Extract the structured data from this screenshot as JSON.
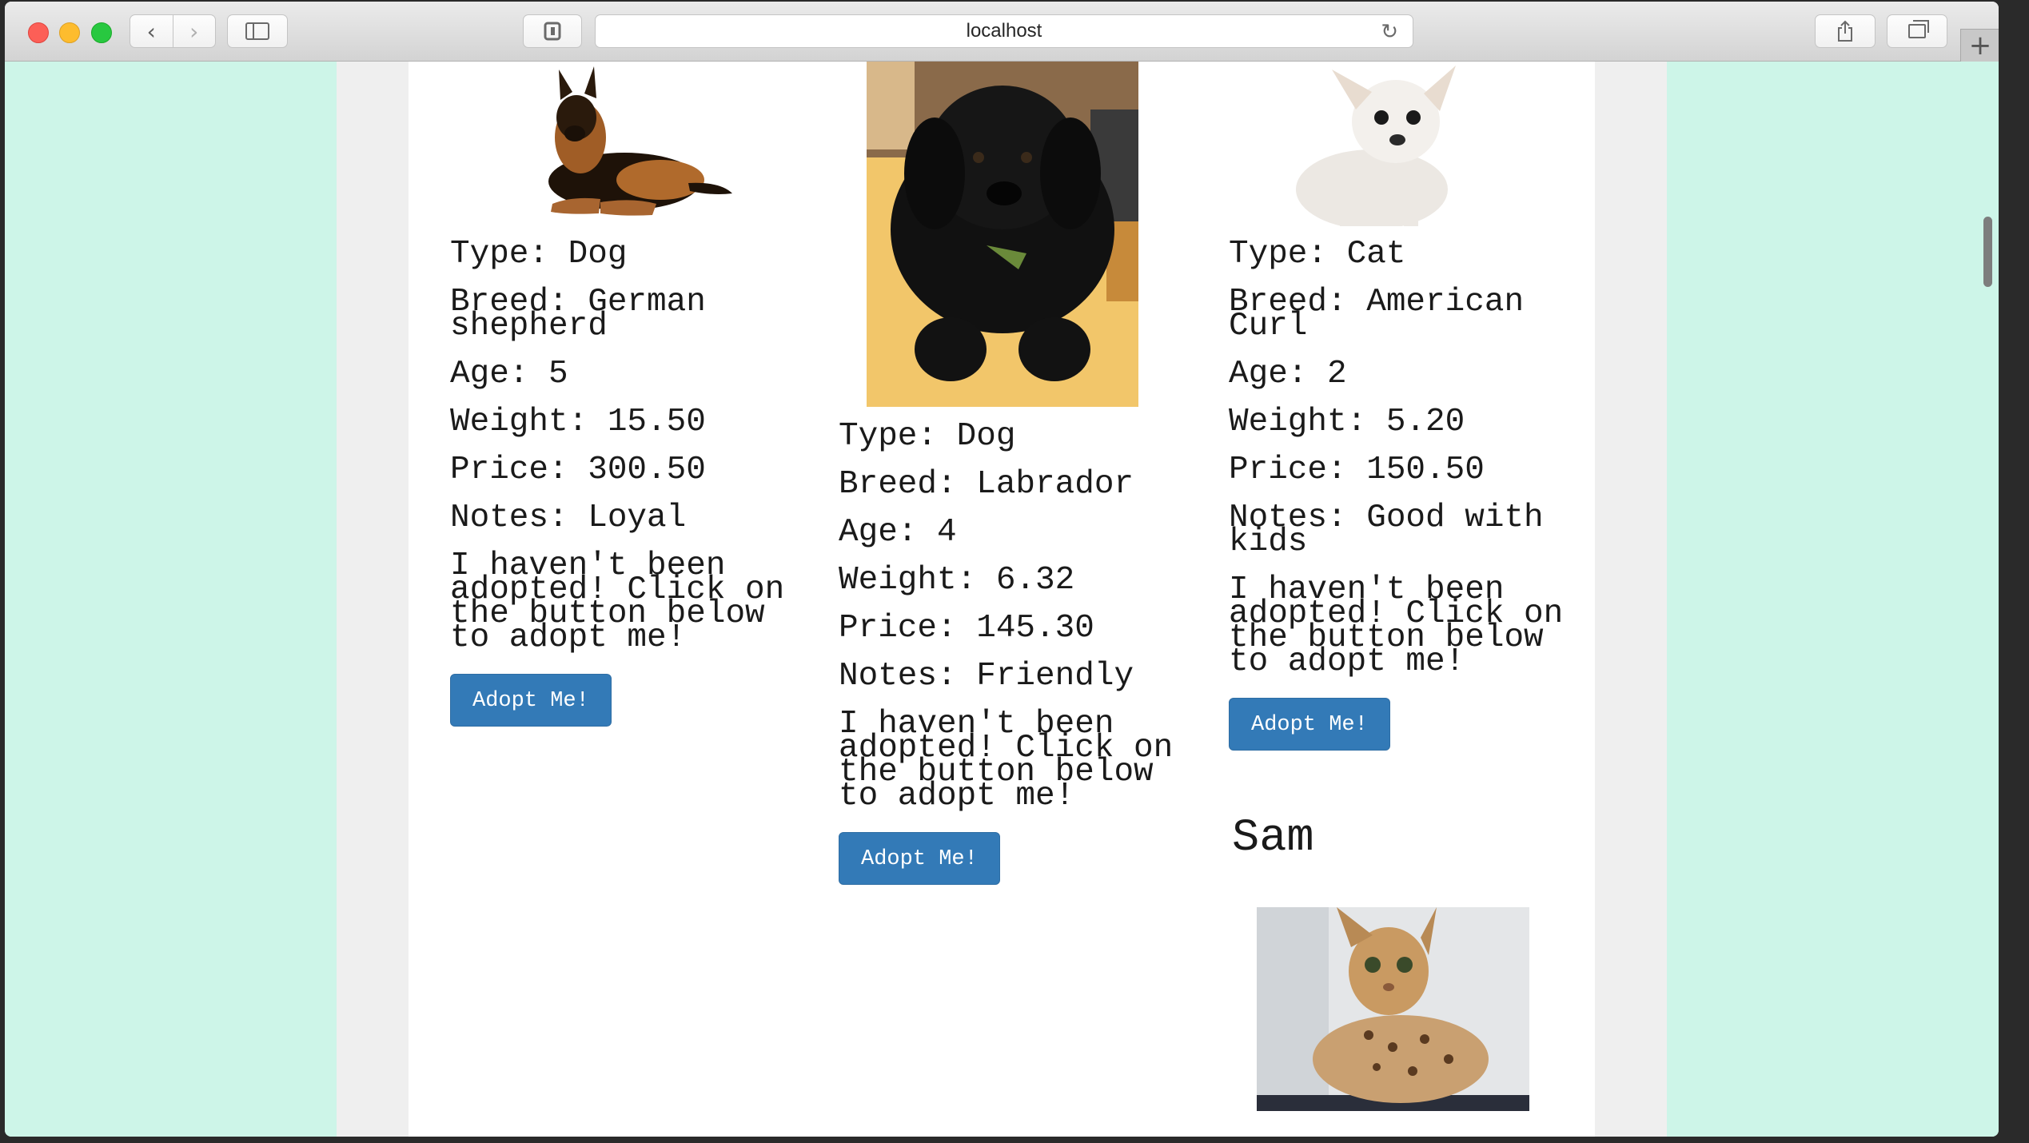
{
  "browser": {
    "address": "localhost",
    "icons": {
      "back": "chevron-left-icon",
      "forward": "chevron-right-icon",
      "sidebar": "sidebar-icon",
      "extension": "extension-icon",
      "reload": "reload-icon",
      "share": "share-icon",
      "tabs": "tabs-icon",
      "new_tab": "plus-icon"
    }
  },
  "colors": {
    "page_background": "#cdf5e8",
    "content_background": "#ffffff",
    "button": "#337ab7"
  },
  "pets": [
    {
      "type_line": "Type: Dog",
      "breed_line": "Breed: German shepherd",
      "age_line": "Age: 5",
      "weight_line": "Weight: 15.50",
      "price_line": "Price: 300.50",
      "notes_line": "Notes: Loyal",
      "message": "I haven't been adopted! Click on the button below to adopt me!",
      "button_label": "Adopt Me!",
      "photo": "german-shepherd-photo"
    },
    {
      "type_line": "Type: Dog",
      "breed_line": "Breed: Labrador",
      "age_line": "Age: 4",
      "weight_line": "Weight: 6.32",
      "price_line": "Price: 145.30",
      "notes_line": "Notes: Friendly",
      "message": "I haven't been adopted! Click on the button below to adopt me!",
      "button_label": "Adopt Me!",
      "photo": "labrador-puppy-photo"
    },
    {
      "type_line": "Type: Cat",
      "breed_line": "Breed: American Curl",
      "age_line": "Age: 2",
      "weight_line": "Weight: 5.20",
      "price_line": "Price: 150.50",
      "notes_line": "Notes: Good with kids",
      "message": "I haven't been adopted! Click on the button below to adopt me!",
      "button_label": "Adopt Me!",
      "photo": "white-chihuahua-photo"
    }
  ],
  "next_pet": {
    "name": "Sam",
    "photo": "bengal-cat-photo"
  }
}
